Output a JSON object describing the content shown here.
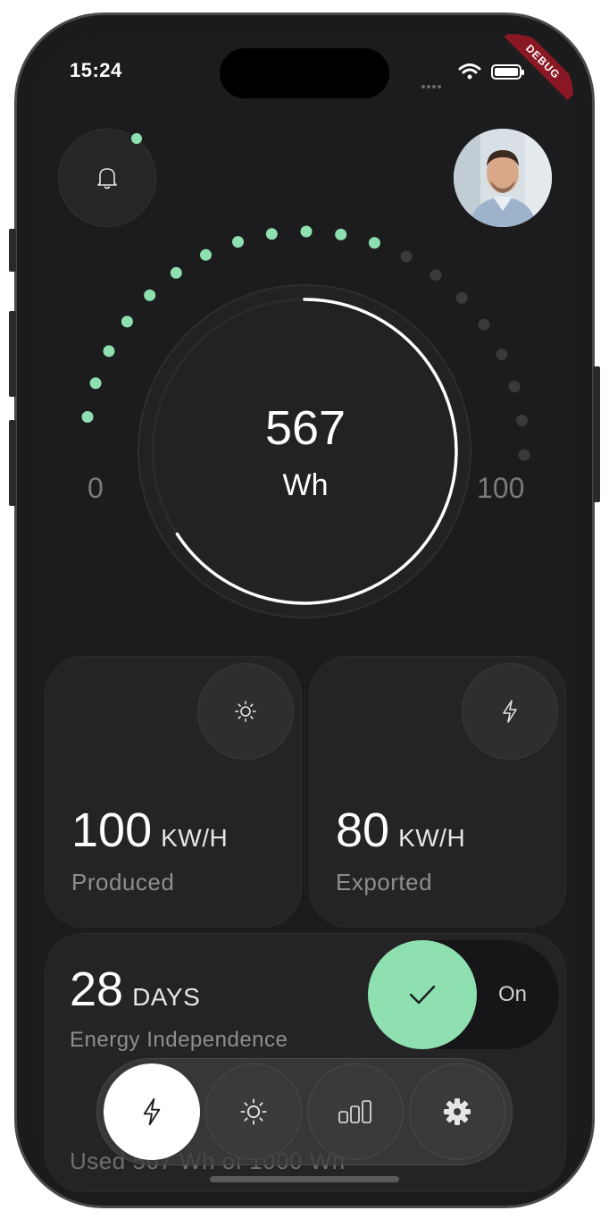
{
  "status_bar": {
    "time": "15:24"
  },
  "debug_banner": "DEBUG",
  "gauge": {
    "value": "567",
    "unit": "Wh",
    "min_label": "0",
    "max_label": "100",
    "active_dots": 12,
    "total_dots": 20
  },
  "cards": {
    "produced": {
      "value": "100",
      "unit": "KW/H",
      "label": "Produced",
      "icon": "sun-icon"
    },
    "exported": {
      "value": "80",
      "unit": "KW/H",
      "label": "Exported",
      "icon": "bolt-icon"
    },
    "independence": {
      "value": "28",
      "unit": "DAYS",
      "label": "Energy Independence",
      "toggle_label": "On",
      "toggle_on": true,
      "footer": "Used 567 Wh of 1000 Wh"
    }
  },
  "nav": [
    {
      "icon": "bolt-icon",
      "active": true
    },
    {
      "icon": "sun-icon",
      "active": false
    },
    {
      "icon": "bar-chart-icon",
      "active": false
    },
    {
      "icon": "gear-icon",
      "active": false
    }
  ],
  "colors": {
    "accent": "#8ee0b1",
    "background": "#1c1c1e",
    "card": "#242426",
    "inactive_dot": "#3a3a3c"
  }
}
